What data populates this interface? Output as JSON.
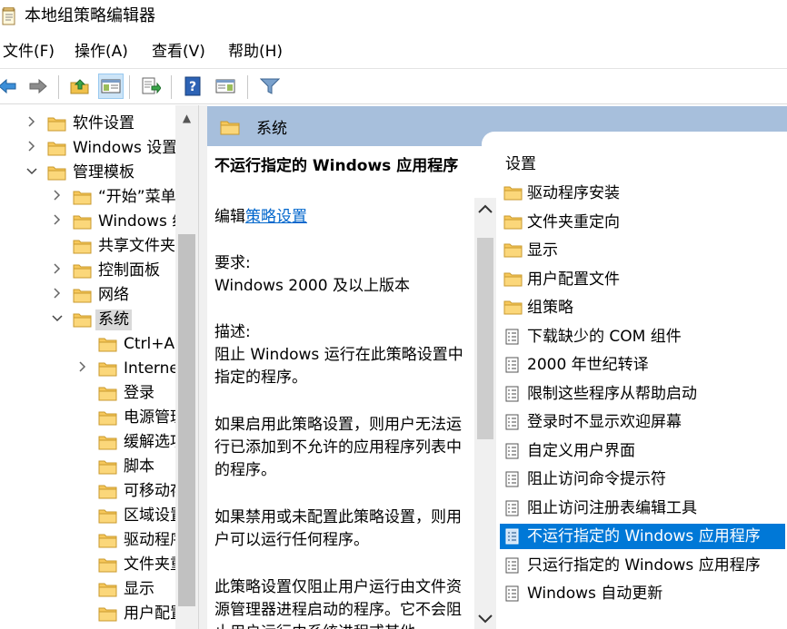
{
  "window": {
    "title": "本地组策略编辑器"
  },
  "menu": [
    {
      "label": "文件(F)"
    },
    {
      "label": "操作(A)"
    },
    {
      "label": "查看(V)"
    },
    {
      "label": "帮助(H)"
    }
  ],
  "toolbar": {
    "buttons": [
      {
        "icon": "back-arrow-icon"
      },
      {
        "icon": "forward-arrow-icon"
      },
      {
        "icon": "up-folder-icon"
      },
      {
        "icon": "show-hide-tree-icon"
      },
      {
        "icon": "export-list-icon"
      },
      {
        "icon": "help-icon"
      },
      {
        "icon": "extended-view-icon"
      },
      {
        "icon": "filter-icon"
      }
    ]
  },
  "tree": {
    "items": [
      {
        "label": "软件设置",
        "expander": ">"
      },
      {
        "label": "Windows 设置",
        "expander": ">"
      },
      {
        "label": "管理模板",
        "expander": "v"
      },
      {
        "label": "“开始”菜单",
        "expander": ">"
      },
      {
        "label": "Windows 组件",
        "expander": ">"
      },
      {
        "label": "共享文件夹",
        "expander": ""
      },
      {
        "label": "控制面板",
        "expander": ">"
      },
      {
        "label": "网络",
        "expander": ">"
      },
      {
        "label": "系统",
        "expander": "v"
      },
      {
        "label": "Ctrl+Alt+Del 选项",
        "expander": ""
      },
      {
        "label": "Internet 通信管理",
        "expander": ">"
      },
      {
        "label": "登录",
        "expander": ""
      },
      {
        "label": "电源管理",
        "expander": ""
      },
      {
        "label": "缓解选项",
        "expander": ""
      },
      {
        "label": "脚本",
        "expander": ""
      },
      {
        "label": "可移动存储访问",
        "expander": ""
      },
      {
        "label": "区域设置服务",
        "expander": ""
      },
      {
        "label": "驱动程序安装",
        "expander": ""
      },
      {
        "label": "文件夹重定向",
        "expander": ""
      },
      {
        "label": "显示",
        "expander": ""
      },
      {
        "label": "用户配置文件",
        "expander": ""
      }
    ]
  },
  "header": {
    "title": "系统"
  },
  "description": {
    "title": "不运行指定的 Windows 应用程序",
    "edit_prefix": "编辑",
    "edit_link": "策略设置",
    "requirements_label": "要求:",
    "requirements_value": "Windows 2000 及以上版本",
    "description_label": "描述:",
    "para1": "阻止 Windows 运行在此策略设置中指定的程序。",
    "para2": "如果启用此策略设置，则用户无法运行已添加到不允许的应用程序列表中的程序。",
    "para3": "如果禁用或未配置此策略设置，则用户可以运行任何程序。",
    "para4": "此策略设置仅阻止用户运行由文件资源管理器进程启动的程序。它不会阻止用户运行由系统进程或其他"
  },
  "list": {
    "column_header": "设置",
    "items": [
      {
        "label": "驱动程序安装",
        "type": "folder"
      },
      {
        "label": "文件夹重定向",
        "type": "folder"
      },
      {
        "label": "显示",
        "type": "folder"
      },
      {
        "label": "用户配置文件",
        "type": "folder"
      },
      {
        "label": "组策略",
        "type": "folder"
      },
      {
        "label": "下载缺少的 COM 组件",
        "type": "setting"
      },
      {
        "label": "2000 年世纪转译",
        "type": "setting"
      },
      {
        "label": "限制这些程序从帮助启动",
        "type": "setting"
      },
      {
        "label": "登录时不显示欢迎屏幕",
        "type": "setting"
      },
      {
        "label": "自定义用户界面",
        "type": "setting"
      },
      {
        "label": "阻止访问命令提示符",
        "type": "setting"
      },
      {
        "label": "阻止访问注册表编辑工具",
        "type": "setting"
      },
      {
        "label": "不运行指定的 Windows 应用程序",
        "type": "setting",
        "selected": true
      },
      {
        "label": "只运行指定的 Windows 应用程序",
        "type": "setting"
      },
      {
        "label": "Windows 自动更新",
        "type": "setting"
      }
    ]
  },
  "colors": {
    "header_bg": "#a7bfdc",
    "selection": "#0078d7",
    "link": "#0066cc",
    "folder": "#f7c85b"
  }
}
